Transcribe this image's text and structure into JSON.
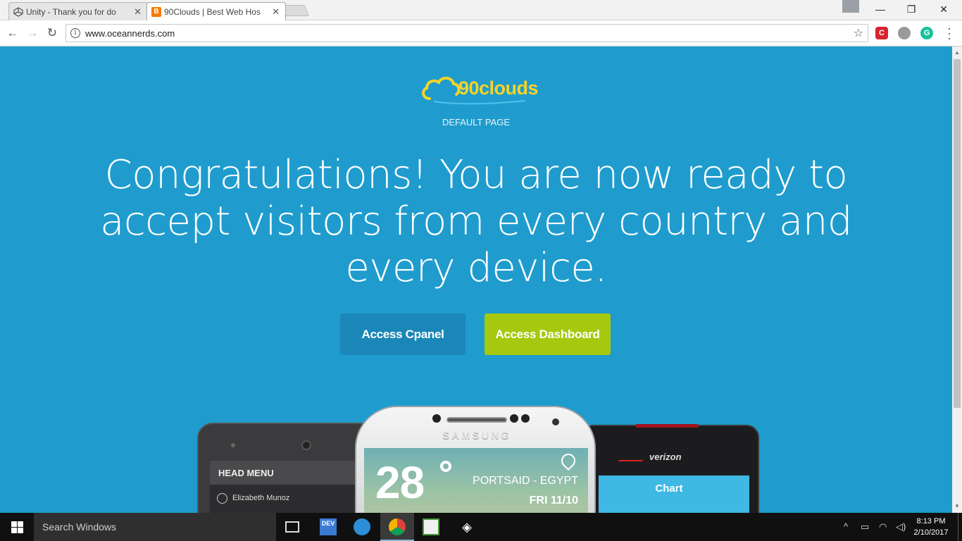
{
  "browser": {
    "tabs": [
      {
        "title": "Unity - Thank you for do",
        "close": "✕"
      },
      {
        "title": "90Clouds | Best Web Hos",
        "close": "✕"
      }
    ],
    "url": "www.oceannerds.com",
    "window_controls": {
      "minimize": "—",
      "restore": "❐",
      "close": "✕"
    }
  },
  "page": {
    "logo_text": "90clouds",
    "subtitle": "DEFAULT PAGE",
    "headline": "Congratulations! You are now ready to accept visitors from every country and every device.",
    "buttons": {
      "cpanel": "Access Cpanel",
      "dashboard": "Access Dashboard"
    },
    "phones": {
      "left": {
        "menu_title": "HEAD MENU",
        "user": "Elizabeth Munoz"
      },
      "center": {
        "brand": "SAMSUNG",
        "temperature": "28",
        "location": "PORTSAID - EGYPT",
        "date": "FRI  11/10"
      },
      "right": {
        "brand": "verizon",
        "screen_title": "Chart"
      }
    },
    "colors": {
      "background": "#1f9ccd",
      "cpanel_button": "#1a87b8",
      "dashboard_button": "#a6c90f",
      "logo": "#f5d327"
    }
  },
  "taskbar": {
    "search_placeholder": "Search Windows",
    "time": "8:13 PM",
    "date": "2/10/2017"
  }
}
